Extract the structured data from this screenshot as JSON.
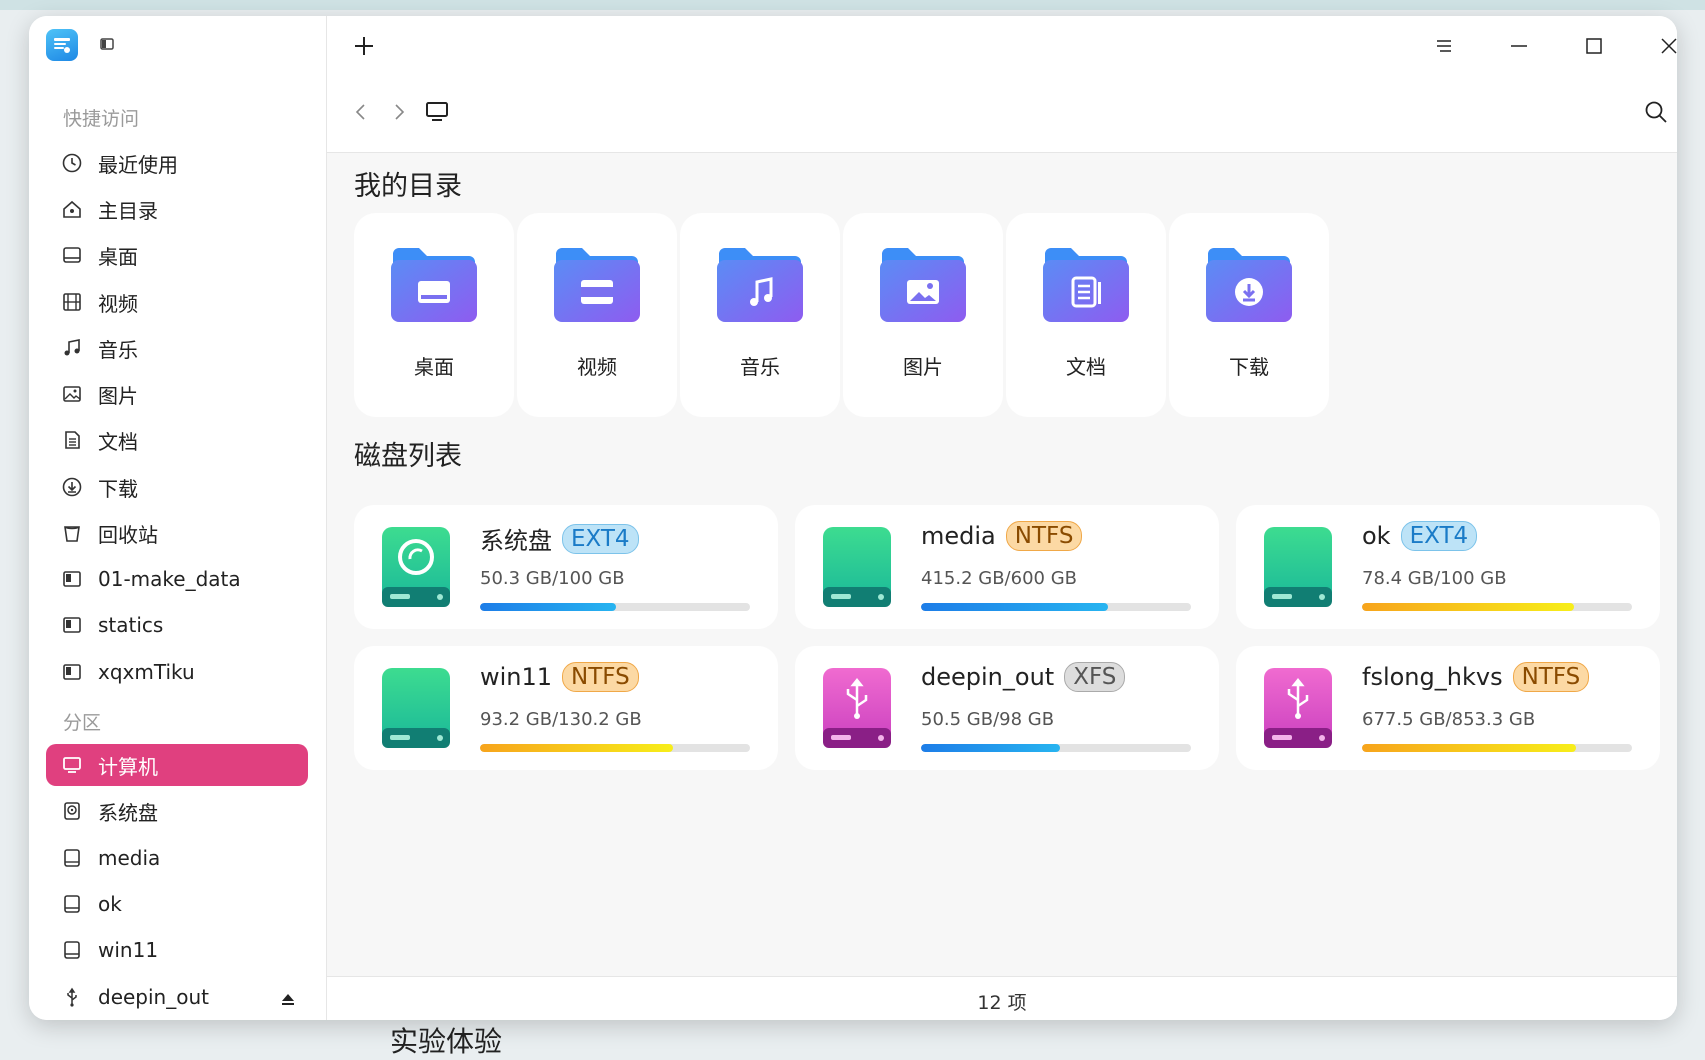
{
  "sidebar": {
    "quick_access_title": "快捷访问",
    "items": [
      {
        "label": "最近使用",
        "icon": "clock-icon"
      },
      {
        "label": "主目录",
        "icon": "home-icon"
      },
      {
        "label": "桌面",
        "icon": "desktop-icon"
      },
      {
        "label": "视频",
        "icon": "film-icon"
      },
      {
        "label": "音乐",
        "icon": "music-icon"
      },
      {
        "label": "图片",
        "icon": "image-icon"
      },
      {
        "label": "文档",
        "icon": "document-icon"
      },
      {
        "label": "下载",
        "icon": "download-icon"
      },
      {
        "label": "回收站",
        "icon": "trash-icon"
      },
      {
        "label": "01-make_data",
        "icon": "folder-icon"
      },
      {
        "label": "statics",
        "icon": "folder-icon"
      },
      {
        "label": "xqxmTiku",
        "icon": "folder-icon"
      }
    ],
    "partitions_title": "分区",
    "partitions": [
      {
        "label": "计算机",
        "icon": "computer-icon",
        "active": true
      },
      {
        "label": "系统盘",
        "icon": "system-disk-icon"
      },
      {
        "label": "media",
        "icon": "disk-icon"
      },
      {
        "label": "ok",
        "icon": "disk-icon"
      },
      {
        "label": "win11",
        "icon": "disk-icon"
      },
      {
        "label": "deepin_out",
        "icon": "usb-icon"
      }
    ]
  },
  "main": {
    "my_directories_title": "我的目录",
    "folders": [
      {
        "label": "桌面",
        "icon": "desktop-folder-icon"
      },
      {
        "label": "视频",
        "icon": "video-folder-icon"
      },
      {
        "label": "音乐",
        "icon": "music-folder-icon"
      },
      {
        "label": "图片",
        "icon": "picture-folder-icon"
      },
      {
        "label": "文档",
        "icon": "document-folder-icon"
      },
      {
        "label": "下载",
        "icon": "download-folder-icon"
      }
    ],
    "disk_list_title": "磁盘列表",
    "disks": [
      {
        "name": "系统盘",
        "fs": "EXT4",
        "size": "50.3 GB/100 GB",
        "usage": 0.503,
        "type": "system"
      },
      {
        "name": "media",
        "fs": "NTFS",
        "size": "415.2 GB/600 GB",
        "usage": 0.692,
        "type": "hdd"
      },
      {
        "name": "ok",
        "fs": "EXT4",
        "size": "78.4 GB/100 GB",
        "usage": 0.784,
        "type": "hdd"
      },
      {
        "name": "win11",
        "fs": "NTFS",
        "size": "93.2 GB/130.2 GB",
        "usage": 0.716,
        "type": "hdd"
      },
      {
        "name": "deepin_out",
        "fs": "XFS",
        "size": "50.5 GB/98 GB",
        "usage": 0.515,
        "type": "usb"
      },
      {
        "name": "fslong_hkvs",
        "fs": "NTFS",
        "size": "677.5 GB/853.3 GB",
        "usage": 0.794,
        "type": "usb"
      }
    ]
  },
  "status": {
    "item_count": "12 项"
  },
  "colors": {
    "accent": "#e0407f",
    "bar_blue": "#1d7de8",
    "bar_yellow": "#f7ee1a"
  },
  "background": {
    "behind_text": "实验体验"
  }
}
